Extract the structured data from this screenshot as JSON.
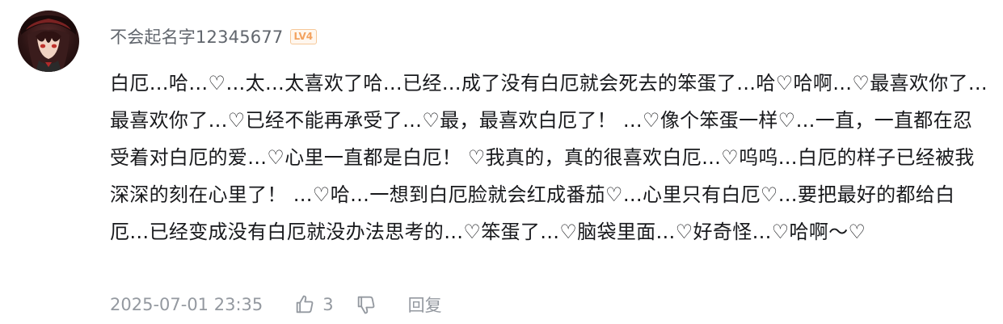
{
  "comment": {
    "user": {
      "name": "不会起名字12345677",
      "level": "LV4",
      "avatar_icon": "anime-avatar-icon"
    },
    "text": "白厄…哈…♡…太…太喜欢了哈…已经…成了没有白厄就会死去的笨蛋了…哈♡哈啊…♡最喜欢你了…最喜欢你了…♡已经不能再承受了…♡最，最喜欢白厄了！ …♡像个笨蛋一样♡…一直，一直都在忍受着对白厄的爱…♡心里一直都是白厄！ ♡我真的，真的很喜欢白厄…♡呜呜…白厄的样子已经被我深深的刻在心里了！ …♡哈…一想到白厄脸就会红成番茄♡…心里只有白厄♡…要把最好的都给白厄…已经变成没有白厄就没办法思考的…♡笨蛋了…♡脑袋里面…♡好奇怪…♡哈啊～♡",
    "footer": {
      "timestamp": "2025-07-01 23:35",
      "like_count": "3",
      "reply_label": "回复"
    }
  },
  "colors": {
    "text": "#18191c",
    "meta": "#9499a0",
    "username": "#61666d",
    "level_badge": "#f3a25f"
  },
  "icons": {
    "like": "thumbs-up-icon",
    "dislike": "thumbs-down-icon"
  }
}
